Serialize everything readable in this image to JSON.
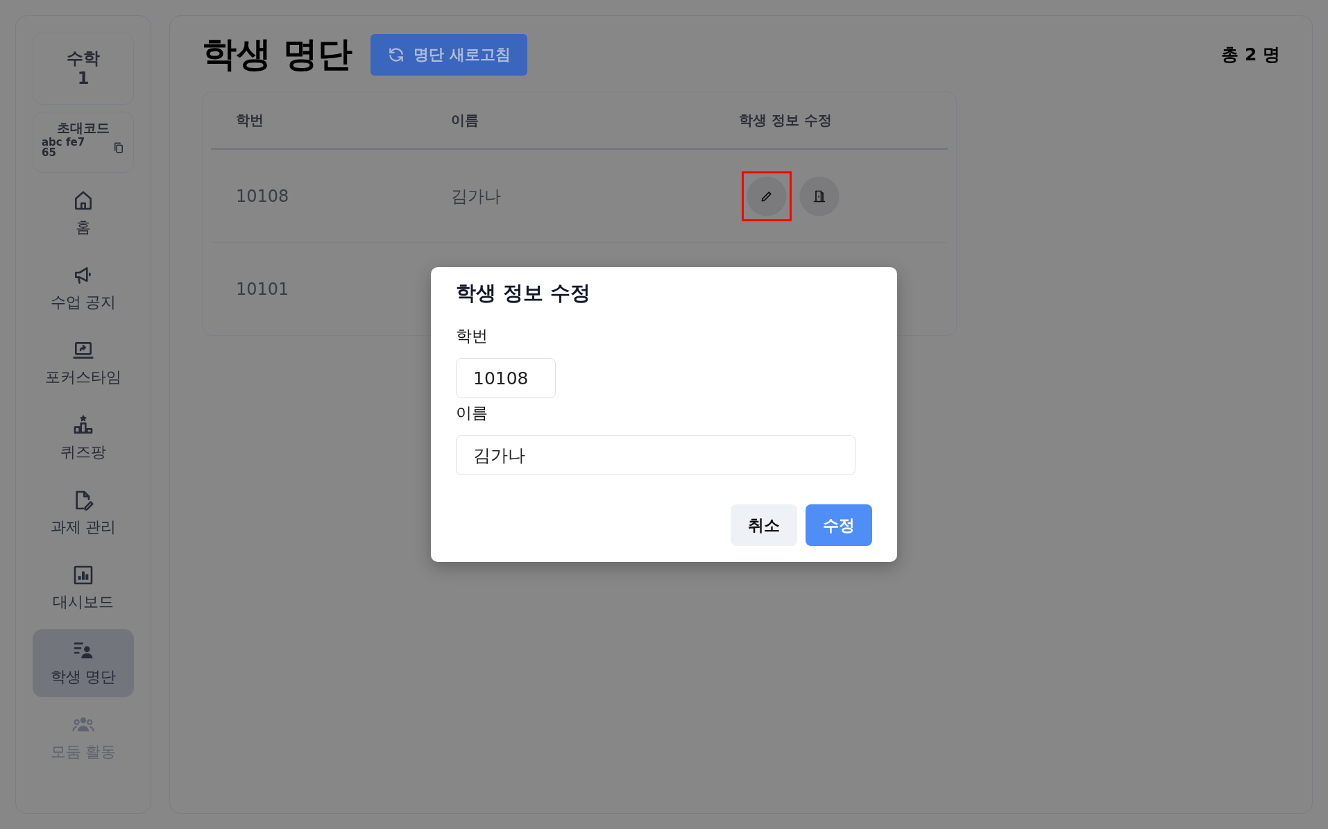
{
  "sidebar": {
    "course": {
      "name": "수학",
      "section": "1"
    },
    "invite": {
      "label": "초대코드",
      "code": "abc fe7 65"
    },
    "items": [
      {
        "label": "홈",
        "selected": false,
        "disabled": false
      },
      {
        "label": "수업 공지",
        "selected": false,
        "disabled": false
      },
      {
        "label": "포커스타임",
        "selected": false,
        "disabled": false
      },
      {
        "label": "퀴즈팡",
        "selected": false,
        "disabled": false
      },
      {
        "label": "과제 관리",
        "selected": false,
        "disabled": false
      },
      {
        "label": "대시보드",
        "selected": false,
        "disabled": false
      },
      {
        "label": "학생 명단",
        "selected": true,
        "disabled": false
      },
      {
        "label": "모둠 활동",
        "selected": false,
        "disabled": true
      }
    ]
  },
  "main": {
    "title": "학생 명단",
    "refresh_button": "명단 새로고침",
    "total": "총 2 명",
    "table": {
      "columns": [
        "학번",
        "이름",
        "학생 정보 수정"
      ],
      "rows": [
        {
          "student_id": "10108",
          "name": "김가나",
          "actions": [
            {
              "kind": "edit",
              "highlighted": true
            },
            {
              "kind": "exit",
              "highlighted": false
            }
          ]
        },
        {
          "student_id": "10101"
        }
      ]
    }
  },
  "modal": {
    "title": "학생 정보 수정",
    "fields": [
      {
        "label": "학번",
        "value": "10108",
        "kind": "short"
      },
      {
        "label": "이름",
        "value": "김가나",
        "kind": "wide"
      }
    ],
    "buttons": [
      {
        "label": "취소",
        "kind": "secondary"
      },
      {
        "label": "수정",
        "kind": "primary"
      }
    ]
  }
}
